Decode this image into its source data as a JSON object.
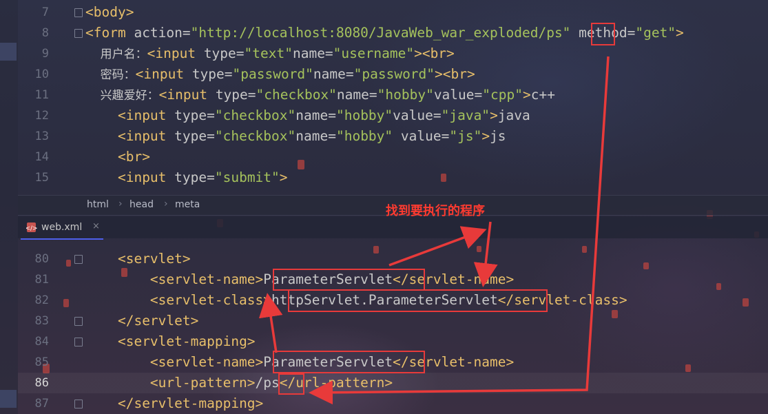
{
  "editor_top": {
    "lines": [
      {
        "n": "7",
        "code": [
          [
            "tag",
            "<body>"
          ]
        ]
      },
      {
        "n": "8",
        "code": [
          [
            "tag",
            "<form "
          ],
          [
            "attr",
            "action="
          ],
          [
            "str",
            "\"http://localhost:8080/JavaWeb_war_exploded/ps\""
          ],
          [
            "attr",
            " method="
          ],
          [
            "str",
            "\"get\""
          ],
          [
            "tag",
            ">"
          ]
        ]
      },
      {
        "n": "9",
        "code": [
          [
            "cn",
            "    用户名："
          ],
          [
            "tag",
            "<input "
          ],
          [
            "attr",
            "type="
          ],
          [
            "str",
            "\"text\""
          ],
          [
            "attr",
            "name="
          ],
          [
            "str",
            "\"username\""
          ],
          [
            "tag",
            ">"
          ],
          [
            "tag",
            "<br>"
          ]
        ]
      },
      {
        "n": "10",
        "code": [
          [
            "cn",
            "    密码："
          ],
          [
            "tag",
            "<input "
          ],
          [
            "attr",
            "type="
          ],
          [
            "str",
            "\"password\""
          ],
          [
            "attr",
            "name="
          ],
          [
            "str",
            "\"password\""
          ],
          [
            "tag",
            ">"
          ],
          [
            "tag",
            "<br>"
          ]
        ]
      },
      {
        "n": "11",
        "code": [
          [
            "cn",
            "    兴趣爱好："
          ],
          [
            "tag",
            "<input "
          ],
          [
            "attr",
            "type="
          ],
          [
            "str",
            "\"checkbox\""
          ],
          [
            "attr",
            "name="
          ],
          [
            "str",
            "\"hobby\""
          ],
          [
            "attr",
            "value="
          ],
          [
            "str",
            "\"cpp\""
          ],
          [
            "tag",
            ">"
          ],
          [
            "txt",
            "c++"
          ]
        ]
      },
      {
        "n": "12",
        "code": [
          [
            "txt",
            "    "
          ],
          [
            "tag",
            "<input "
          ],
          [
            "attr",
            "type="
          ],
          [
            "str",
            "\"checkbox\""
          ],
          [
            "attr",
            "name="
          ],
          [
            "str",
            "\"hobby\""
          ],
          [
            "attr",
            "value="
          ],
          [
            "str",
            "\"java\""
          ],
          [
            "tag",
            ">"
          ],
          [
            "txt",
            "java"
          ]
        ]
      },
      {
        "n": "13",
        "code": [
          [
            "txt",
            "    "
          ],
          [
            "tag",
            "<input "
          ],
          [
            "attr",
            "type="
          ],
          [
            "str",
            "\"checkbox\""
          ],
          [
            "attr",
            "name="
          ],
          [
            "str",
            "\"hobby\""
          ],
          [
            "attr",
            " value="
          ],
          [
            "str",
            "\"js\""
          ],
          [
            "tag",
            ">"
          ],
          [
            "txt",
            "js"
          ]
        ]
      },
      {
        "n": "14",
        "code": [
          [
            "txt",
            "    "
          ],
          [
            "tag",
            "<br>"
          ]
        ]
      },
      {
        "n": "15",
        "code": [
          [
            "txt",
            "    "
          ],
          [
            "tag",
            "<input "
          ],
          [
            "attr",
            "type="
          ],
          [
            "str",
            "\"submit\""
          ],
          [
            "tag",
            ">"
          ]
        ]
      }
    ]
  },
  "breadcrumb": {
    "items": [
      "html",
      "head",
      "meta"
    ]
  },
  "tab": {
    "label": "web.xml",
    "close": "×"
  },
  "editor_bottom": {
    "lines": [
      {
        "n": "80",
        "code": [
          [
            "txt",
            "    "
          ],
          [
            "tag",
            "<servlet>"
          ]
        ]
      },
      {
        "n": "81",
        "code": [
          [
            "txt",
            "        "
          ],
          [
            "tag",
            "<servlet-name>"
          ],
          [
            "txt",
            "ParameterServlet"
          ],
          [
            "tag",
            "</servlet-name>"
          ]
        ]
      },
      {
        "n": "82",
        "code": [
          [
            "txt",
            "        "
          ],
          [
            "tag",
            "<servlet-class>"
          ],
          [
            "txt",
            "httpServlet.ParameterServlet"
          ],
          [
            "tag",
            "</servlet-class>"
          ]
        ]
      },
      {
        "n": "83",
        "code": [
          [
            "txt",
            "    "
          ],
          [
            "tag",
            "</servlet>"
          ]
        ]
      },
      {
        "n": "84",
        "code": [
          [
            "txt",
            "    "
          ],
          [
            "tag",
            "<servlet-mapping>"
          ]
        ]
      },
      {
        "n": "85",
        "code": [
          [
            "txt",
            "        "
          ],
          [
            "tag",
            "<servlet-name>"
          ],
          [
            "txt",
            "ParameterServlet"
          ],
          [
            "tag",
            "</servlet-name>"
          ]
        ]
      },
      {
        "n": "86",
        "code": [
          [
            "txt",
            "        "
          ],
          [
            "tag",
            "<url-pattern>"
          ],
          [
            "txt",
            "/ps"
          ],
          [
            "tag",
            "</url-pattern>"
          ]
        ]
      },
      {
        "n": "87",
        "code": [
          [
            "txt",
            "    "
          ],
          [
            "tag",
            "</servlet-mapping>"
          ]
        ]
      }
    ]
  },
  "annotation": {
    "text": "找到要执行的程序"
  },
  "colors": {
    "annotation_red": "#e83a3a",
    "tag": "#e8bf6a",
    "string": "#a5c25c",
    "text": "#c8c8c8"
  }
}
